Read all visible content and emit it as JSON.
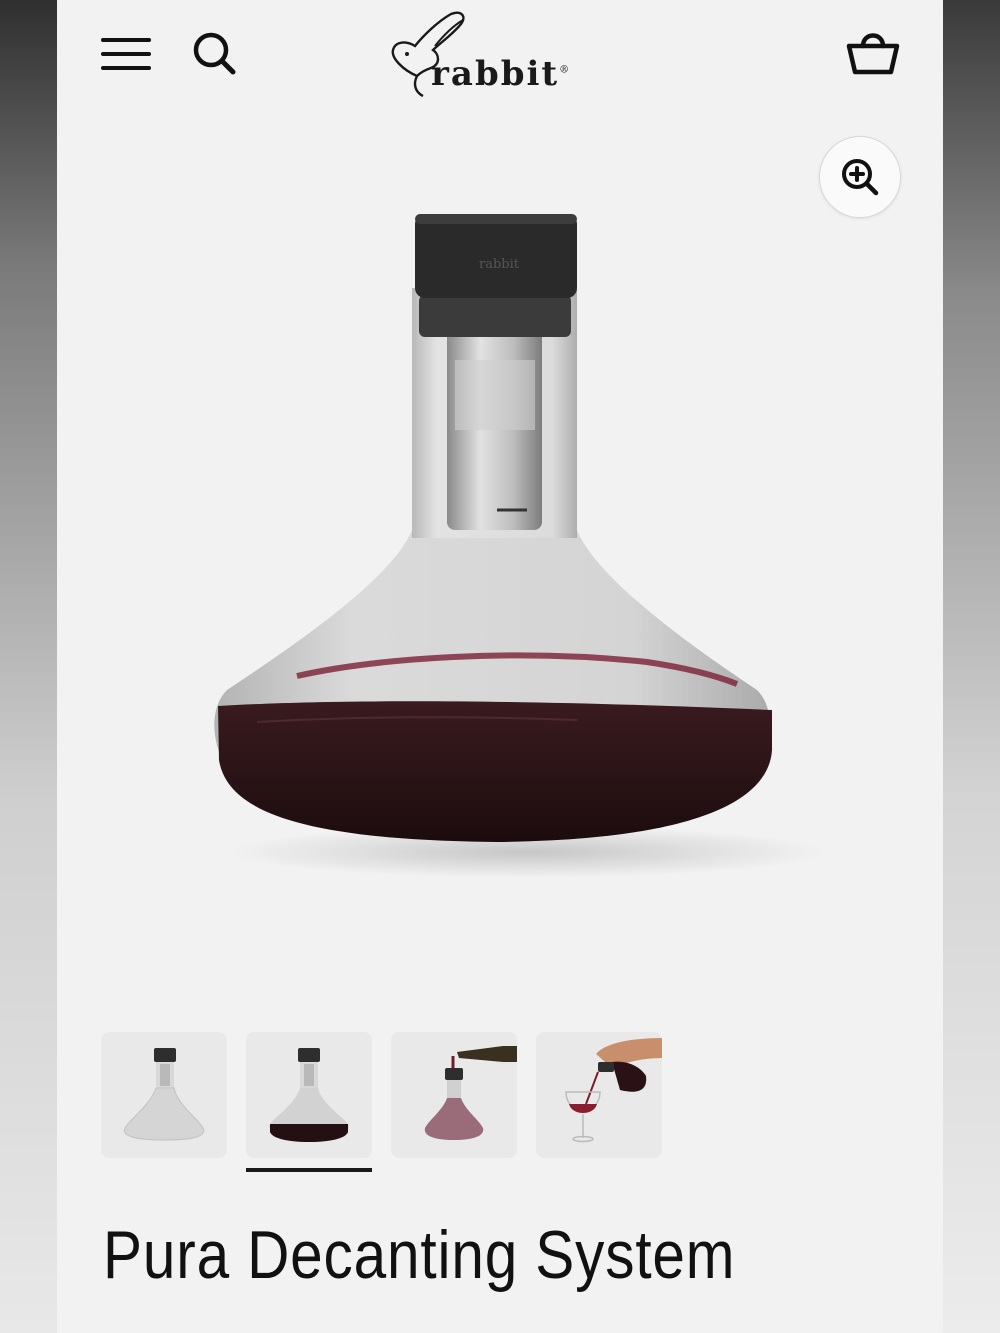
{
  "header": {
    "menu_icon": "hamburger-menu-icon",
    "search_icon": "search-icon",
    "logo_text": "rabbit",
    "logo_mark": "®",
    "cart_icon": "basket-icon"
  },
  "hero": {
    "zoom_icon": "zoom-in-icon",
    "cap_logo_text": "rabbit"
  },
  "gallery": {
    "thumbnails": [
      {
        "name": "empty-decanter"
      },
      {
        "name": "decanter-with-wine",
        "active": true
      },
      {
        "name": "pouring-into-decanter"
      },
      {
        "name": "pouring-into-glass"
      }
    ]
  },
  "product": {
    "title": "Pura Decanting System"
  },
  "colors": {
    "page_bg": "#f2f2f2",
    "wine": "#2a1316",
    "text": "#111111"
  }
}
